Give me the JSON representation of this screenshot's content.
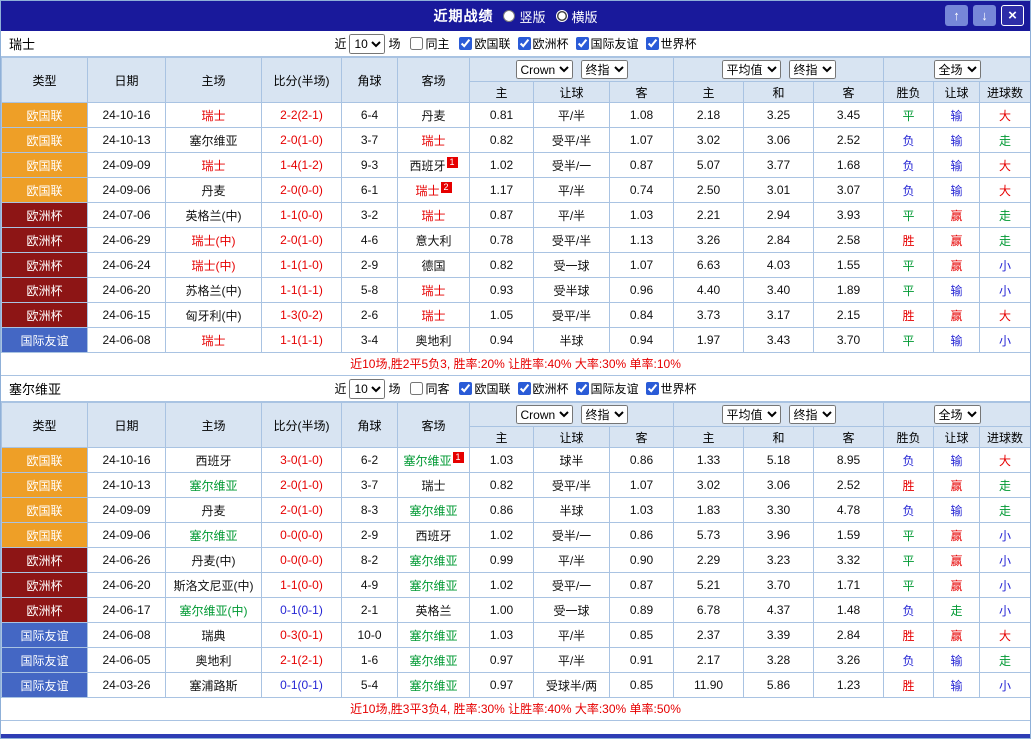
{
  "theme": {
    "titlebar_bg": "#19199b",
    "titlebar_button_bg": "#7687d8",
    "header_bg": "#d8e4f2",
    "table_border": "#a9c3e2",
    "badge_nations_league": "#ee9f27",
    "badge_euro": "#8d1515",
    "badge_friendly": "#4467c4",
    "focus_home_team_color": "#e60000",
    "focus_away_team_color": "#009933",
    "win_red": "#e60000",
    "draw_green": "#009933",
    "loss_blue": "#2525d4",
    "summary_text": "#e60000",
    "bottom_bar": "#2e3db4"
  },
  "icons": {
    "up": "↑",
    "down": "↓",
    "close": "×"
  },
  "titlebar": {
    "title": "近期战绩",
    "vertical_label": "竖版",
    "horizontal_label": "横版",
    "vertical_selected": false,
    "horizontal_selected": true
  },
  "filters": {
    "recent_pre": "近",
    "recent_value": "10",
    "recent_post": "场",
    "leagues": [
      {
        "label": "欧国联",
        "checked": true
      },
      {
        "label": "欧洲杯",
        "checked": true
      },
      {
        "label": "国际友谊",
        "checked": true
      },
      {
        "label": "世界杯",
        "checked": true
      }
    ]
  },
  "controls": {
    "book": "Crown",
    "book_stage": "终指",
    "avg": "平均值",
    "avg_stage": "终指",
    "scope": "全场"
  },
  "columns": {
    "type": "类型",
    "date": "日期",
    "home": "主场",
    "score": "比分(半场)",
    "corners": "角球",
    "away": "客场",
    "odds_home": "主",
    "odds_line": "让球",
    "odds_away": "客",
    "avg_home": "主",
    "avg_draw": "和",
    "avg_away": "客",
    "res_wdl": "胜负",
    "res_ah": "让球",
    "res_ou": "进球数"
  },
  "sections": [
    {
      "team": "瑞士",
      "venue_label": "同主",
      "venue_checked": false,
      "summary": "近10场,胜2平5负3, 胜率:20% 让胜率:40% 大率:30% 单率:10%",
      "rows": [
        {
          "comp": "欧国联",
          "comp_color": "orange",
          "date": "24-10-16",
          "home": "瑞士",
          "home_color": "red",
          "home_sup": "",
          "score": "2-2(2-1)",
          "score_color": "red",
          "corners": "6-4",
          "away": "丹麦",
          "away_color": "black",
          "away_sup": "",
          "bk_home": "0.81",
          "bk_line": "平/半",
          "bk_away": "1.08",
          "avg_home": "2.18",
          "avg_draw": "3.25",
          "avg_away": "3.45",
          "res_wdl": "平",
          "res_wdl_color": "green",
          "res_ah": "输",
          "res_ah_color": "blue",
          "res_ou": "大",
          "res_ou_color": "red"
        },
        {
          "comp": "欧国联",
          "comp_color": "orange",
          "date": "24-10-13",
          "home": "塞尔维亚",
          "home_color": "black",
          "home_sup": "",
          "score": "2-0(1-0)",
          "score_color": "red",
          "corners": "3-7",
          "away": "瑞士",
          "away_color": "red",
          "away_sup": "",
          "bk_home": "0.82",
          "bk_line": "受平/半",
          "bk_away": "1.07",
          "avg_home": "3.02",
          "avg_draw": "3.06",
          "avg_away": "2.52",
          "res_wdl": "负",
          "res_wdl_color": "blue",
          "res_ah": "输",
          "res_ah_color": "blue",
          "res_ou": "走",
          "res_ou_color": "green"
        },
        {
          "comp": "欧国联",
          "comp_color": "orange",
          "date": "24-09-09",
          "home": "瑞士",
          "home_color": "red",
          "home_sup": "",
          "score": "1-4(1-2)",
          "score_color": "red",
          "corners": "9-3",
          "away": "西班牙",
          "away_color": "black",
          "away_sup": "1",
          "bk_home": "1.02",
          "bk_line": "受半/一",
          "bk_away": "0.87",
          "avg_home": "5.07",
          "avg_draw": "3.77",
          "avg_away": "1.68",
          "res_wdl": "负",
          "res_wdl_color": "blue",
          "res_ah": "输",
          "res_ah_color": "blue",
          "res_ou": "大",
          "res_ou_color": "red"
        },
        {
          "comp": "欧国联",
          "comp_color": "orange",
          "date": "24-09-06",
          "home": "丹麦",
          "home_color": "black",
          "home_sup": "",
          "score": "2-0(0-0)",
          "score_color": "red",
          "corners": "6-1",
          "away": "瑞士",
          "away_color": "red",
          "away_sup": "2",
          "bk_home": "1.17",
          "bk_line": "平/半",
          "bk_away": "0.74",
          "avg_home": "2.50",
          "avg_draw": "3.01",
          "avg_away": "3.07",
          "res_wdl": "负",
          "res_wdl_color": "blue",
          "res_ah": "输",
          "res_ah_color": "blue",
          "res_ou": "大",
          "res_ou_color": "red"
        },
        {
          "comp": "欧洲杯",
          "comp_color": "maroon",
          "date": "24-07-06",
          "home": "英格兰(中)",
          "home_color": "black",
          "home_sup": "",
          "score": "1-1(0-0)",
          "score_color": "red",
          "corners": "3-2",
          "away": "瑞士",
          "away_color": "red",
          "away_sup": "",
          "bk_home": "0.87",
          "bk_line": "平/半",
          "bk_away": "1.03",
          "avg_home": "2.21",
          "avg_draw": "2.94",
          "avg_away": "3.93",
          "res_wdl": "平",
          "res_wdl_color": "green",
          "res_ah": "赢",
          "res_ah_color": "red",
          "res_ou": "走",
          "res_ou_color": "green"
        },
        {
          "comp": "欧洲杯",
          "comp_color": "maroon",
          "date": "24-06-29",
          "home": "瑞士(中)",
          "home_color": "red",
          "home_sup": "",
          "score": "2-0(1-0)",
          "score_color": "red",
          "corners": "4-6",
          "away": "意大利",
          "away_color": "black",
          "away_sup": "",
          "bk_home": "0.78",
          "bk_line": "受平/半",
          "bk_away": "1.13",
          "avg_home": "3.26",
          "avg_draw": "2.84",
          "avg_away": "2.58",
          "res_wdl": "胜",
          "res_wdl_color": "red",
          "res_ah": "赢",
          "res_ah_color": "red",
          "res_ou": "走",
          "res_ou_color": "green"
        },
        {
          "comp": "欧洲杯",
          "comp_color": "maroon",
          "date": "24-06-24",
          "home": "瑞士(中)",
          "home_color": "red",
          "home_sup": "",
          "score": "1-1(1-0)",
          "score_color": "red",
          "corners": "2-9",
          "away": "德国",
          "away_color": "black",
          "away_sup": "",
          "bk_home": "0.82",
          "bk_line": "受一球",
          "bk_away": "1.07",
          "avg_home": "6.63",
          "avg_draw": "4.03",
          "avg_away": "1.55",
          "res_wdl": "平",
          "res_wdl_color": "green",
          "res_ah": "赢",
          "res_ah_color": "red",
          "res_ou": "小",
          "res_ou_color": "blue"
        },
        {
          "comp": "欧洲杯",
          "comp_color": "maroon",
          "date": "24-06-20",
          "home": "苏格兰(中)",
          "home_color": "black",
          "home_sup": "",
          "score": "1-1(1-1)",
          "score_color": "red",
          "corners": "5-8",
          "away": "瑞士",
          "away_color": "red",
          "away_sup": "",
          "bk_home": "0.93",
          "bk_line": "受半球",
          "bk_away": "0.96",
          "avg_home": "4.40",
          "avg_draw": "3.40",
          "avg_away": "1.89",
          "res_wdl": "平",
          "res_wdl_color": "green",
          "res_ah": "输",
          "res_ah_color": "blue",
          "res_ou": "小",
          "res_ou_color": "blue"
        },
        {
          "comp": "欧洲杯",
          "comp_color": "maroon",
          "date": "24-06-15",
          "home": "匈牙利(中)",
          "home_color": "black",
          "home_sup": "",
          "score": "1-3(0-2)",
          "score_color": "red",
          "corners": "2-6",
          "away": "瑞士",
          "away_color": "red",
          "away_sup": "",
          "bk_home": "1.05",
          "bk_line": "受平/半",
          "bk_away": "0.84",
          "avg_home": "3.73",
          "avg_draw": "3.17",
          "avg_away": "2.15",
          "res_wdl": "胜",
          "res_wdl_color": "red",
          "res_ah": "赢",
          "res_ah_color": "red",
          "res_ou": "大",
          "res_ou_color": "red"
        },
        {
          "comp": "国际友谊",
          "comp_color": "blue",
          "date": "24-06-08",
          "home": "瑞士",
          "home_color": "red",
          "home_sup": "",
          "score": "1-1(1-1)",
          "score_color": "red",
          "corners": "3-4",
          "away": "奥地利",
          "away_color": "black",
          "away_sup": "",
          "bk_home": "0.94",
          "bk_line": "半球",
          "bk_away": "0.94",
          "avg_home": "1.97",
          "avg_draw": "3.43",
          "avg_away": "3.70",
          "res_wdl": "平",
          "res_wdl_color": "green",
          "res_ah": "输",
          "res_ah_color": "blue",
          "res_ou": "小",
          "res_ou_color": "blue"
        }
      ]
    },
    {
      "team": "塞尔维亚",
      "venue_label": "同客",
      "venue_checked": false,
      "summary": "近10场,胜3平3负4, 胜率:30% 让胜率:40% 大率:30% 单率:50%",
      "rows": [
        {
          "comp": "欧国联",
          "comp_color": "orange",
          "date": "24-10-16",
          "home": "西班牙",
          "home_color": "black",
          "home_sup": "",
          "score": "3-0(1-0)",
          "score_color": "red",
          "corners": "6-2",
          "away": "塞尔维亚",
          "away_color": "green",
          "away_sup": "1",
          "bk_home": "1.03",
          "bk_line": "球半",
          "bk_away": "0.86",
          "avg_home": "1.33",
          "avg_draw": "5.18",
          "avg_away": "8.95",
          "res_wdl": "负",
          "res_wdl_color": "blue",
          "res_ah": "输",
          "res_ah_color": "blue",
          "res_ou": "大",
          "res_ou_color": "red"
        },
        {
          "comp": "欧国联",
          "comp_color": "orange",
          "date": "24-10-13",
          "home": "塞尔维亚",
          "home_color": "green",
          "home_sup": "",
          "score": "2-0(1-0)",
          "score_color": "red",
          "corners": "3-7",
          "away": "瑞士",
          "away_color": "black",
          "away_sup": "",
          "bk_home": "0.82",
          "bk_line": "受平/半",
          "bk_away": "1.07",
          "avg_home": "3.02",
          "avg_draw": "3.06",
          "avg_away": "2.52",
          "res_wdl": "胜",
          "res_wdl_color": "red",
          "res_ah": "赢",
          "res_ah_color": "red",
          "res_ou": "走",
          "res_ou_color": "green"
        },
        {
          "comp": "欧国联",
          "comp_color": "orange",
          "date": "24-09-09",
          "home": "丹麦",
          "home_color": "black",
          "home_sup": "",
          "score": "2-0(1-0)",
          "score_color": "red",
          "corners": "8-3",
          "away": "塞尔维亚",
          "away_color": "green",
          "away_sup": "",
          "bk_home": "0.86",
          "bk_line": "半球",
          "bk_away": "1.03",
          "avg_home": "1.83",
          "avg_draw": "3.30",
          "avg_away": "4.78",
          "res_wdl": "负",
          "res_wdl_color": "blue",
          "res_ah": "输",
          "res_ah_color": "blue",
          "res_ou": "走",
          "res_ou_color": "green"
        },
        {
          "comp": "欧国联",
          "comp_color": "orange",
          "date": "24-09-06",
          "home": "塞尔维亚",
          "home_color": "green",
          "home_sup": "",
          "score": "0-0(0-0)",
          "score_color": "red",
          "corners": "2-9",
          "away": "西班牙",
          "away_color": "black",
          "away_sup": "",
          "bk_home": "1.02",
          "bk_line": "受半/一",
          "bk_away": "0.86",
          "avg_home": "5.73",
          "avg_draw": "3.96",
          "avg_away": "1.59",
          "res_wdl": "平",
          "res_wdl_color": "green",
          "res_ah": "赢",
          "res_ah_color": "red",
          "res_ou": "小",
          "res_ou_color": "blue"
        },
        {
          "comp": "欧洲杯",
          "comp_color": "maroon",
          "date": "24-06-26",
          "home": "丹麦(中)",
          "home_color": "black",
          "home_sup": "",
          "score": "0-0(0-0)",
          "score_color": "red",
          "corners": "8-2",
          "away": "塞尔维亚",
          "away_color": "green",
          "away_sup": "",
          "bk_home": "0.99",
          "bk_line": "平/半",
          "bk_away": "0.90",
          "avg_home": "2.29",
          "avg_draw": "3.23",
          "avg_away": "3.32",
          "res_wdl": "平",
          "res_wdl_color": "green",
          "res_ah": "赢",
          "res_ah_color": "red",
          "res_ou": "小",
          "res_ou_color": "blue"
        },
        {
          "comp": "欧洲杯",
          "comp_color": "maroon",
          "date": "24-06-20",
          "home": "斯洛文尼亚(中)",
          "home_color": "black",
          "home_sup": "",
          "score": "1-1(0-0)",
          "score_color": "red",
          "corners": "4-9",
          "away": "塞尔维亚",
          "away_color": "green",
          "away_sup": "",
          "bk_home": "1.02",
          "bk_line": "受平/一",
          "bk_away": "0.87",
          "avg_home": "5.21",
          "avg_draw": "3.70",
          "avg_away": "1.71",
          "res_wdl": "平",
          "res_wdl_color": "green",
          "res_ah": "赢",
          "res_ah_color": "red",
          "res_ou": "小",
          "res_ou_color": "blue"
        },
        {
          "comp": "欧洲杯",
          "comp_color": "maroon",
          "date": "24-06-17",
          "home": "塞尔维亚(中)",
          "home_color": "green",
          "home_sup": "",
          "score": "0-1(0-1)",
          "score_color": "blue",
          "corners": "2-1",
          "away": "英格兰",
          "away_color": "black",
          "away_sup": "",
          "bk_home": "1.00",
          "bk_line": "受一球",
          "bk_away": "0.89",
          "avg_home": "6.78",
          "avg_draw": "4.37",
          "avg_away": "1.48",
          "res_wdl": "负",
          "res_wdl_color": "blue",
          "res_ah": "走",
          "res_ah_color": "green",
          "res_ou": "小",
          "res_ou_color": "blue"
        },
        {
          "comp": "国际友谊",
          "comp_color": "blue",
          "date": "24-06-08",
          "home": "瑞典",
          "home_color": "black",
          "home_sup": "",
          "score": "0-3(0-1)",
          "score_color": "red",
          "corners": "10-0",
          "away": "塞尔维亚",
          "away_color": "green",
          "away_sup": "",
          "bk_home": "1.03",
          "bk_line": "平/半",
          "bk_away": "0.85",
          "avg_home": "2.37",
          "avg_draw": "3.39",
          "avg_away": "2.84",
          "res_wdl": "胜",
          "res_wdl_color": "red",
          "res_ah": "赢",
          "res_ah_color": "red",
          "res_ou": "大",
          "res_ou_color": "red"
        },
        {
          "comp": "国际友谊",
          "comp_color": "blue",
          "date": "24-06-05",
          "home": "奥地利",
          "home_color": "black",
          "home_sup": "",
          "score": "2-1(2-1)",
          "score_color": "red",
          "corners": "1-6",
          "away": "塞尔维亚",
          "away_color": "green",
          "away_sup": "",
          "bk_home": "0.97",
          "bk_line": "平/半",
          "bk_away": "0.91",
          "avg_home": "2.17",
          "avg_draw": "3.28",
          "avg_away": "3.26",
          "res_wdl": "负",
          "res_wdl_color": "blue",
          "res_ah": "输",
          "res_ah_color": "blue",
          "res_ou": "走",
          "res_ou_color": "green"
        },
        {
          "comp": "国际友谊",
          "comp_color": "blue",
          "date": "24-03-26",
          "home": "塞浦路斯",
          "home_color": "black",
          "home_sup": "",
          "score": "0-1(0-1)",
          "score_color": "blue",
          "corners": "5-4",
          "away": "塞尔维亚",
          "away_color": "green",
          "away_sup": "",
          "bk_home": "0.97",
          "bk_line": "受球半/两",
          "bk_away": "0.85",
          "avg_home": "11.90",
          "avg_draw": "5.86",
          "avg_away": "1.23",
          "res_wdl": "胜",
          "res_wdl_color": "red",
          "res_ah": "输",
          "res_ah_color": "blue",
          "res_ou": "小",
          "res_ou_color": "blue"
        }
      ]
    }
  ]
}
